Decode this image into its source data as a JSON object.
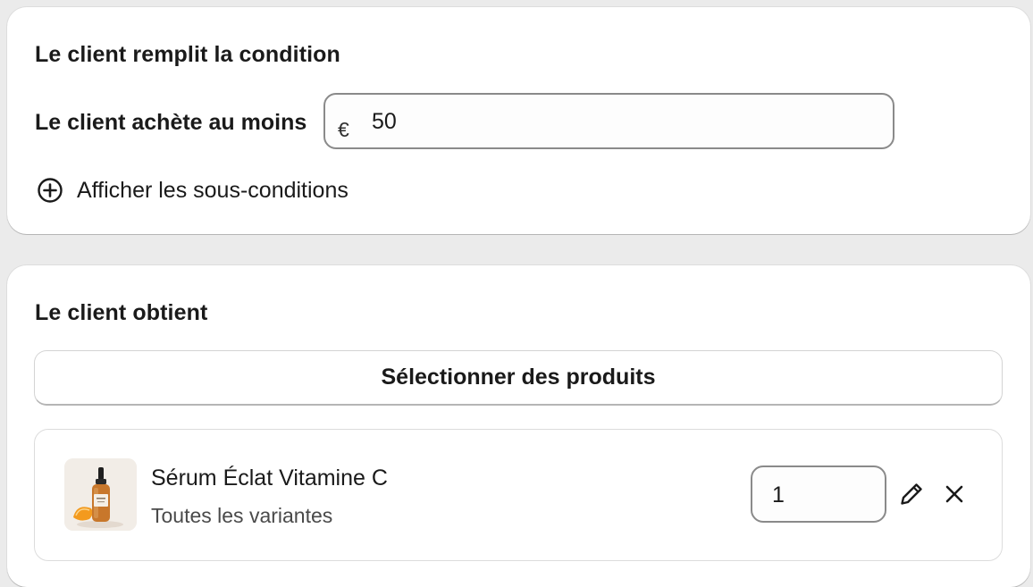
{
  "condition": {
    "title": "Le client remplit la condition",
    "min_purchase_label": "Le client achète au moins",
    "currency_symbol": "€",
    "amount_value": "50",
    "subconditions_label": "Afficher les sous-conditions",
    "subconditions_icon": "plus-circle-icon"
  },
  "reward": {
    "title": "Le client obtient",
    "select_products_label": "Sélectionner des produits",
    "product": {
      "name": "Sérum Éclat Vitamine C",
      "variants": "Toutes les variantes",
      "quantity": "1",
      "thumbnail_icon": "serum-bottle-image",
      "edit_icon": "pencil-icon",
      "remove_icon": "close-icon"
    }
  },
  "colors": {
    "background": "#ebebeb",
    "card": "#ffffff",
    "field_border": "#8a8a8a",
    "text": "#1a1a1a"
  }
}
